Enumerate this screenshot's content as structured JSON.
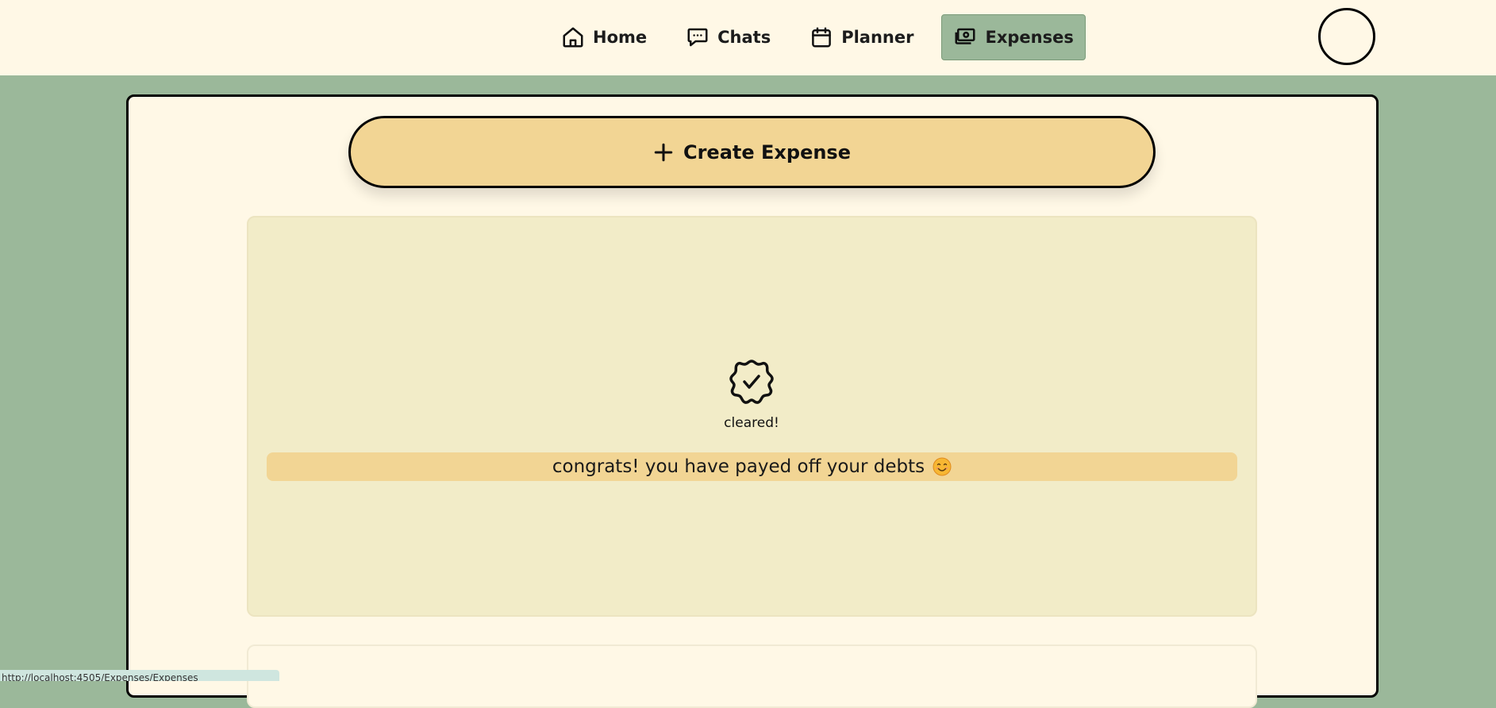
{
  "nav": {
    "items": [
      {
        "label": "Home",
        "icon": "home-icon"
      },
      {
        "label": "Chats",
        "icon": "chat-icon"
      },
      {
        "label": "Planner",
        "icon": "calendar-icon"
      },
      {
        "label": "Expenses",
        "icon": "money-icon",
        "active": true
      }
    ]
  },
  "profile": {
    "icon": "avatar"
  },
  "main": {
    "create_button": {
      "label": "Create Expense",
      "icon": "plus-icon"
    },
    "status_card": {
      "icon": "verified-badge-icon",
      "status_label": "cleared!",
      "message": "congrats! you have payed off your debts",
      "emoji": "smiling-face-icon"
    }
  },
  "status_bar": {
    "url": "http://localhost:4505/Expenses/Expenses"
  },
  "colors": {
    "background": "#9bb89a",
    "surface": "#fff8e6",
    "accent": "#f2d594",
    "card": "#f2ecc8",
    "active_nav": "#9bb89a"
  }
}
